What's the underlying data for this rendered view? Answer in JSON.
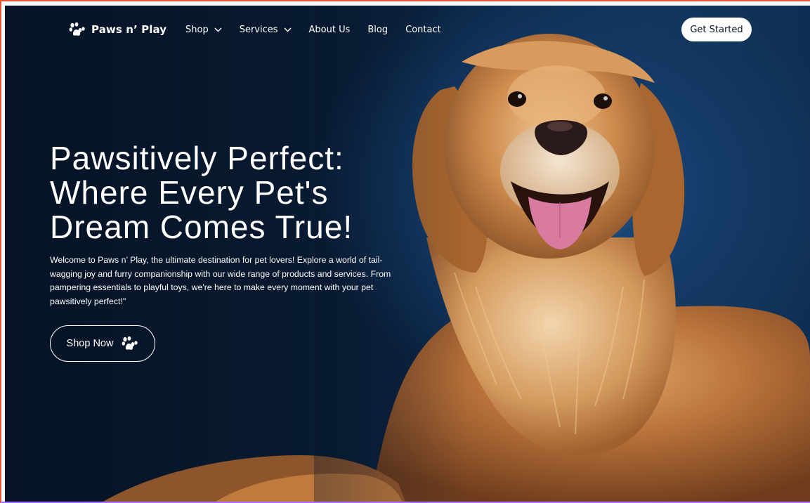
{
  "brand": {
    "name": "Paws n’ Play",
    "logo_icon": "paw-icon"
  },
  "nav": {
    "items": [
      {
        "label": "Shop",
        "has_dropdown": true
      },
      {
        "label": "Services",
        "has_dropdown": true
      },
      {
        "label": "About Us",
        "has_dropdown": false
      },
      {
        "label": "Blog",
        "has_dropdown": false
      },
      {
        "label": "Contact",
        "has_dropdown": false
      }
    ],
    "cta_label": "Get Started"
  },
  "hero": {
    "headline_line1": "Pawsitively Perfect:",
    "headline_line2": "Where Every Pet's",
    "headline_line3": "Dream Comes True!",
    "intro": "Welcome to Paws n’ Play, the ultimate destination for pet lovers! Explore a world of tail-wagging joy and furry companionship with our wide range of products and services. From pampering essentials to playful toys, we're here to make every moment with your pet pawsitively perfect!\"",
    "button_label": "Shop Now",
    "button_icon": "paw-icon"
  },
  "colors": {
    "background_dark": "#061326",
    "background_blue": "#1e4f86",
    "text": "#ffffff",
    "cta_bg": "#ffffff",
    "cta_text": "#0b1626",
    "dog_fur": "#c07a3c"
  }
}
